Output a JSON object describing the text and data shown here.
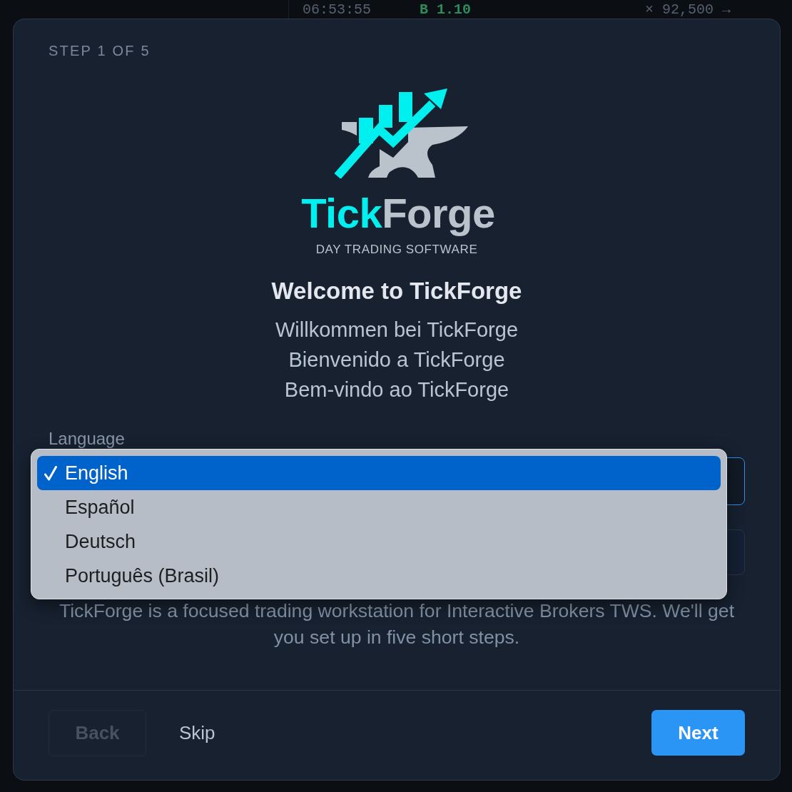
{
  "background": {
    "ticker": [
      {
        "text": "06:53:55",
        "kind": "time"
      },
      {
        "text": "B 1.10",
        "kind": "bid"
      },
      {
        "text": "× 92,500 →",
        "kind": "size"
      }
    ]
  },
  "dialog": {
    "step": "STEP 1 OF 5",
    "logo": {
      "wordmark_parts": [
        "Tick",
        "Forge"
      ],
      "tagline": "DAY TRADING SOFTWARE"
    },
    "heading": "Welcome to TickForge",
    "translations": [
      "Willkommen bei TickForge",
      "Bienvenido a TickForge",
      "Bem-vindo ao TickForge"
    ],
    "language": {
      "label": "Language",
      "menu": [
        {
          "label": "English",
          "selected": true
        },
        {
          "label": "Español",
          "selected": false
        },
        {
          "label": "Deutsch",
          "selected": false
        },
        {
          "label": "Português (Brasil)",
          "selected": false
        }
      ]
    },
    "description": "TickForge is a focused trading workstation for Interactive Brokers TWS. We'll get you set up in five short steps.",
    "buttons": [
      {
        "label": "Back",
        "kind": "outline",
        "disabled": true
      },
      {
        "label": "Skip",
        "kind": "link",
        "disabled": false
      },
      {
        "label": "Next",
        "kind": "primary",
        "disabled": false
      }
    ]
  }
}
